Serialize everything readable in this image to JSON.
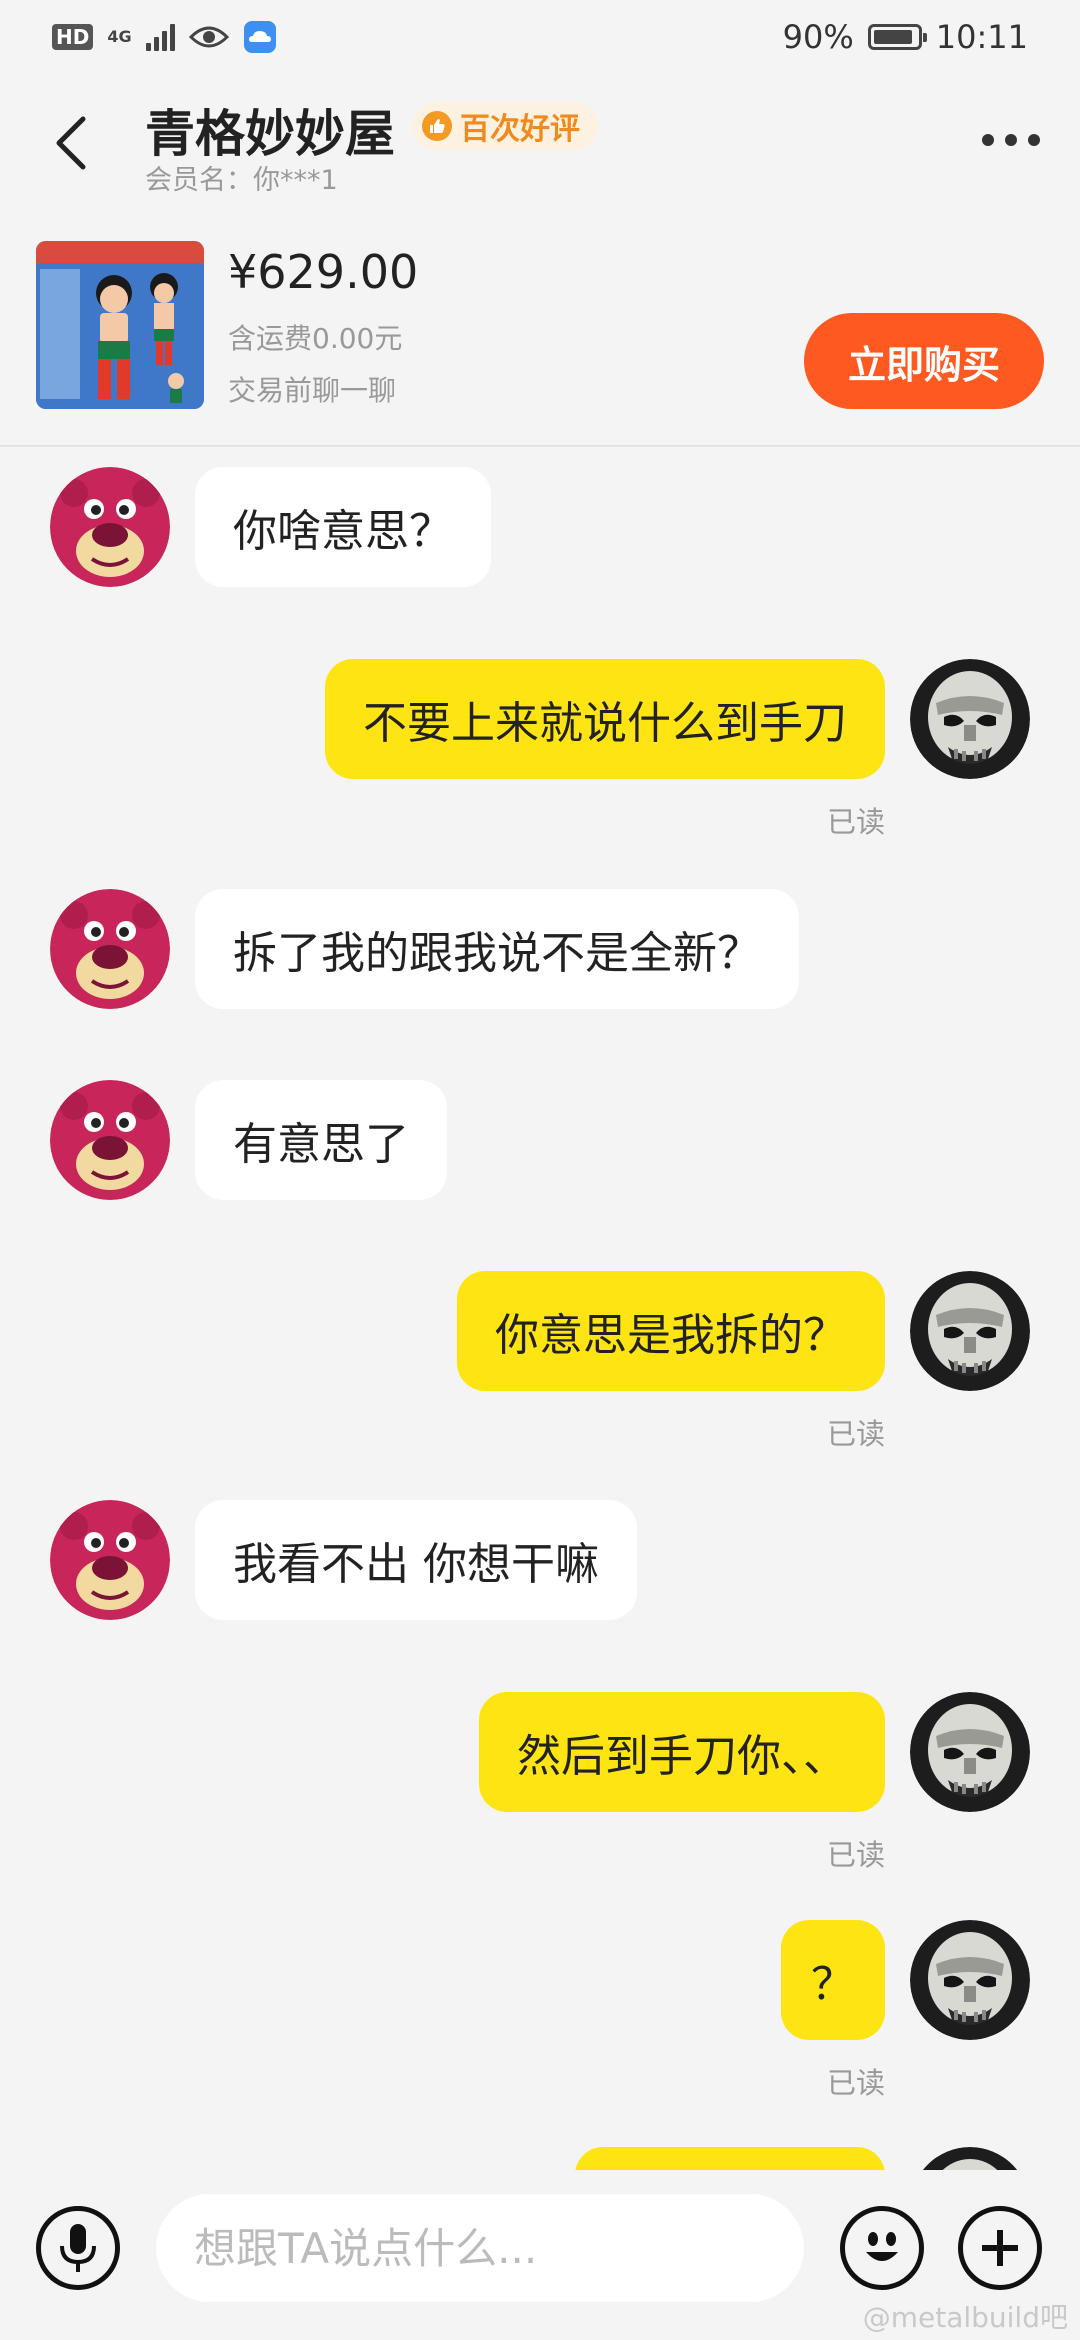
{
  "status_bar": {
    "network": "4G",
    "battery": "90%",
    "battery_level": 0.9,
    "time": "10:11"
  },
  "header": {
    "shop_name": "青格妙妙屋",
    "badge": "百次好评",
    "member_label": "会员名：你***1"
  },
  "product": {
    "price": "¥629.00",
    "shipping": "含运费0.00元",
    "note": "交易前聊一聊",
    "buy_label": "立即购买"
  },
  "messages": [
    {
      "side": "in",
      "text": "你啥意思？"
    },
    {
      "side": "out",
      "text": "不要上来就说什么到手刀",
      "status": "已读"
    },
    {
      "side": "in",
      "text": "拆了我的跟我说不是全新？"
    },
    {
      "side": "in",
      "text": "有意思了"
    },
    {
      "side": "out",
      "text": "你意思是我拆的？",
      "status": "已读"
    },
    {
      "side": "in",
      "text": "我看不出 你想干嘛"
    },
    {
      "side": "out",
      "text": "然后到手刀你、、",
      "status": "已读"
    },
    {
      "side": "out",
      "text": "？",
      "status": "已读"
    },
    {
      "side": "out",
      "text": ""
    }
  ],
  "input": {
    "placeholder": "想跟TA说点什么..."
  },
  "watermark": "@metalbuild吧",
  "colors": {
    "accent_orange": "#ff5922",
    "bubble_yellow": "#ffe414",
    "badge_orange": "#f08a1c"
  }
}
